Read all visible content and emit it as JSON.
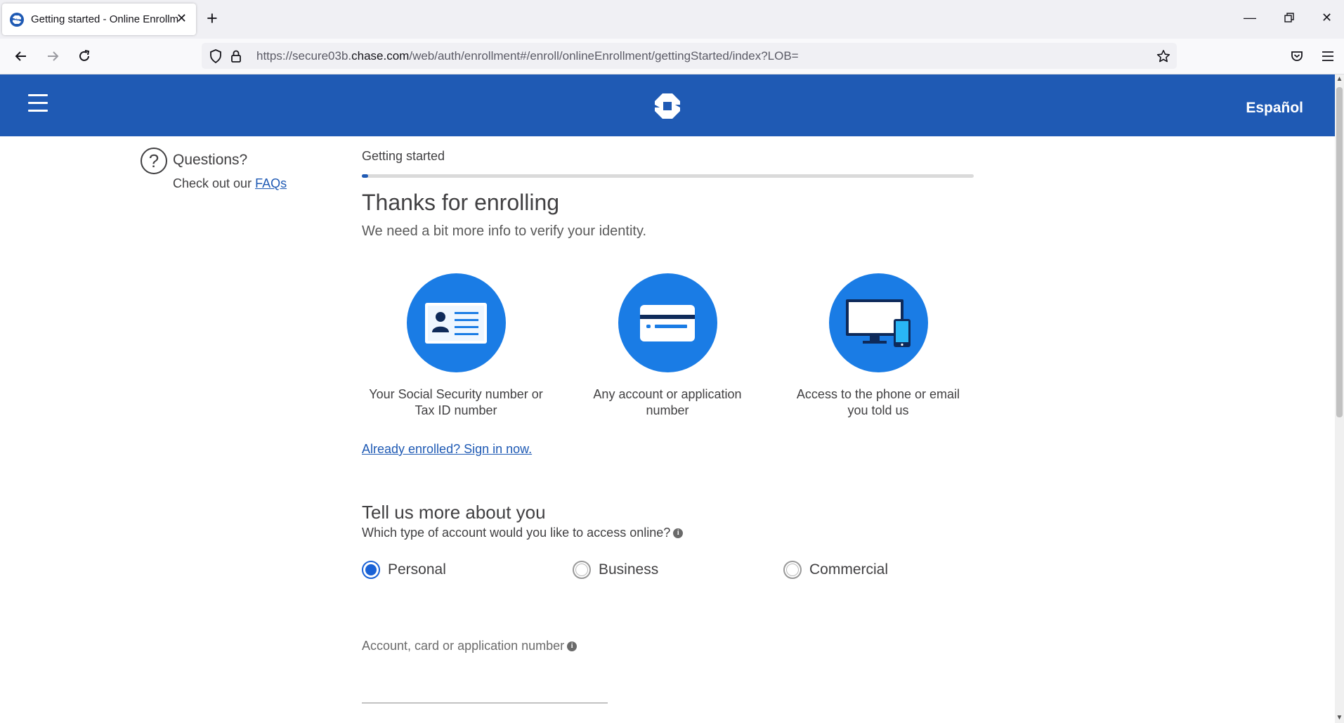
{
  "browser": {
    "tab_title": "Getting started - Online Enrollm",
    "url_prefix": "https://secure03b.",
    "url_host": "chase.com",
    "url_path": "/web/auth/enrollment#/enroll/onlineEnrollment/gettingStarted/index?LOB="
  },
  "header": {
    "language_link": "Español",
    "brand_color": "#1f5ab4"
  },
  "sidebar": {
    "questions_title": "Questions?",
    "faq_prefix": "Check out our ",
    "faq_link": "FAQs"
  },
  "main": {
    "step_label": "Getting started",
    "progress_fraction": 0.01,
    "title": "Thanks for enrolling",
    "subtitle": "We need a bit more info to verify your identity.",
    "requirements": [
      {
        "icon": "id-card-icon",
        "line1": "Your Social Security number or",
        "line2": "Tax ID number"
      },
      {
        "icon": "credit-card-icon",
        "line1": "Any account or application",
        "line2": "number"
      },
      {
        "icon": "devices-icon",
        "line1": "Access to the phone or email",
        "line2": "you told us"
      }
    ],
    "signin_link": "Already enrolled? Sign in now.",
    "more_title": "Tell us more about you",
    "account_question": "Which type of account would you like to access online?",
    "account_types": [
      {
        "label": "Personal",
        "selected": true
      },
      {
        "label": "Business",
        "selected": false
      },
      {
        "label": "Commercial",
        "selected": false
      }
    ],
    "account_number_label": "Account, card or application number",
    "account_number_value": ""
  },
  "info_glyph": "i"
}
